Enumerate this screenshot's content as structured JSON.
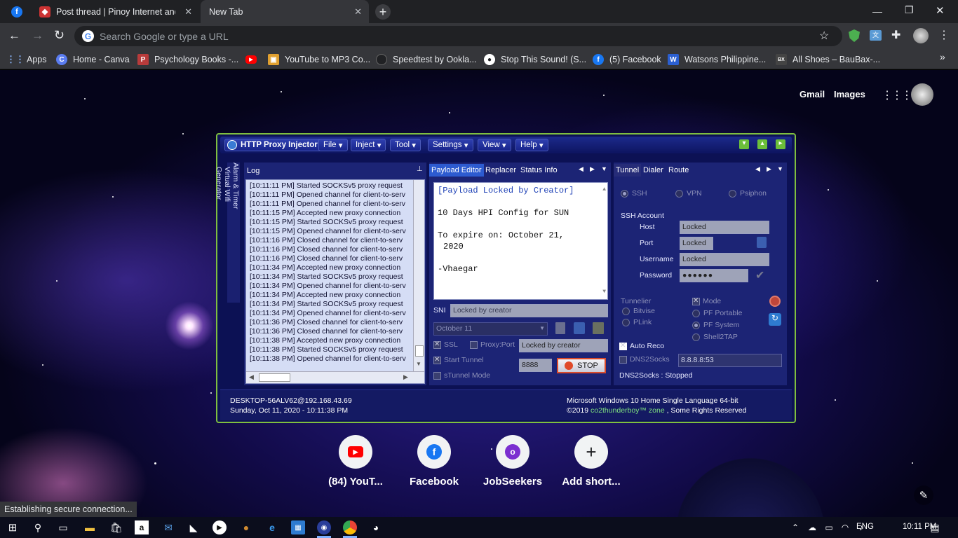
{
  "tabs": [
    {
      "label": "Post thread | Pinoy Internet and Technology Forums",
      "active": false
    },
    {
      "label": "New Tab",
      "active": true
    }
  ],
  "omnibox": {
    "placeholder": "Search Google or type a URL"
  },
  "bookmarks": [
    {
      "label": "Apps",
      "icon": "apps-grid-icon",
      "color": "#8ab4f8"
    },
    {
      "label": "Home - Canva",
      "icon": "canva-icon",
      "color": "#5a7cf0"
    },
    {
      "label": "Psychology Books -...",
      "icon": "pdf-icon",
      "color": "#b83b3b"
    },
    {
      "label": "",
      "icon": "youtube-icon",
      "color": "#ff0000"
    },
    {
      "label": "YouTube to MP3 Co...",
      "icon": "converter-icon",
      "color": "#e0a030"
    },
    {
      "label": "Speedtest by Ookla...",
      "icon": "speedtest-icon",
      "color": "#202124"
    },
    {
      "label": "Stop This Sound! (S...",
      "icon": "stop-sound-icon",
      "color": "#ffffff"
    },
    {
      "label": "(5) Facebook",
      "icon": "facebook-icon",
      "color": "#1877f2"
    },
    {
      "label": "Watsons Philippine...",
      "icon": "watsons-icon",
      "color": "#2b5fd0"
    },
    {
      "label": "All Shoes – BauBax-...",
      "icon": "baubax-icon",
      "color": "#444"
    }
  ],
  "ntp": {
    "gmail": "Gmail",
    "images": "Images"
  },
  "app": {
    "title": "HTTP Proxy Injector",
    "menu": [
      "File",
      "Inject",
      "Tool",
      "Settings",
      "View",
      "Help"
    ],
    "side_tabs": [
      "Alarm & Timer",
      "Virtual Wifi",
      "Generator"
    ],
    "log_title": "Log",
    "log": [
      "[10:11:11 PM] Started SOCKSv5 proxy request",
      "[10:11:11 PM] Opened channel for client-to-serv",
      "[10:11:11 PM] Opened channel for client-to-serv",
      "[10:11:15 PM] Accepted new proxy connection",
      "[10:11:15 PM] Started SOCKSv5 proxy request",
      "[10:11:15 PM] Opened channel for client-to-serv",
      "[10:11:16 PM] Closed channel for client-to-serv",
      "[10:11:16 PM] Closed channel for client-to-serv",
      "[10:11:16 PM] Closed channel for client-to-serv",
      "[10:11:34 PM] Accepted new proxy connection",
      "[10:11:34 PM] Started SOCKSv5 proxy request",
      "[10:11:34 PM] Opened channel for client-to-serv",
      "[10:11:34 PM] Accepted new proxy connection",
      "[10:11:34 PM] Started SOCKSv5 proxy request",
      "[10:11:34 PM] Opened channel for client-to-serv",
      "[10:11:36 PM] Closed channel for client-to-serv",
      "[10:11:36 PM] Closed channel for client-to-serv",
      "[10:11:38 PM] Accepted new proxy connection",
      "[10:11:38 PM] Started SOCKSv5 proxy request",
      "[10:11:38 PM] Opened channel for client-to-serv"
    ],
    "mid_tabs": [
      "Payload Editor",
      "Replacer",
      "Status Info"
    ],
    "payload": [
      "[Payload Locked by Creator]",
      "",
      "10 Days HPI Config for SUN",
      "",
      "To expire on: October 21,",
      "2020",
      "",
      "-Vhaegar"
    ],
    "sni_label": "SNI",
    "sni_value": "Locked by creator",
    "date_select": "October 11",
    "ssl_label": "SSL",
    "proxy_port_label": "Proxy:Port",
    "proxy_value": "Locked by creator",
    "start_tunnel_label": "Start Tunnel",
    "port_value": "8888",
    "stop_label": "STOP",
    "stunnel_label": "sTunnel Mode",
    "right_tabs": [
      "Tunnel",
      "Dialer",
      "Route"
    ],
    "protocols": [
      "SSH",
      "VPN",
      "Psiphon"
    ],
    "ssh_account_label": "SSH Account",
    "host_label": "Host",
    "host_value": "Locked",
    "port_label": "Port",
    "port_field": "Locked",
    "username_label": "Username",
    "username_value": "Locked",
    "password_label": "Password",
    "password_value": "●●●●●●",
    "tunnelier_label": "Tunnelier",
    "bitvise_label": "Bitvise",
    "plink_label": "PLink",
    "mode_label": "Mode",
    "pf_portable_label": "PF Portable",
    "pf_system_label": "PF System",
    "shell2tap_label": "Shell2TAP",
    "auto_reco_label": "Auto Reco",
    "dns2socks_label": "DNS2Socks",
    "dns_value": "8.8.8.8:53",
    "dns_status": "DNS2Socks : Stopped",
    "footer_host": "DESKTOP-56ALV62@192.168.43.69",
    "footer_date": "Sunday, Oct 11, 2020 - 10:11:38 PM",
    "footer_os": "Microsoft Windows 10 Home Single Language 64-bit",
    "footer_copy_prefix": "©2019 ",
    "footer_copy_link": "co2thunderboy™ zone",
    "footer_copy_suffix": " , Some Rights Reserved"
  },
  "shortcuts": [
    {
      "label": "(84) YouT...",
      "icon": "youtube-icon",
      "color": "#ff0000"
    },
    {
      "label": "Facebook",
      "icon": "facebook-icon",
      "color": "#1877f2"
    },
    {
      "label": "JobSeekers",
      "icon": "jobseekers-icon",
      "color": "#7b2fd0"
    },
    {
      "label": "Add short...",
      "icon": "plus-icon",
      "color": "#202124"
    }
  ],
  "status_bar": "Establishing secure connection...",
  "tray": {
    "lang": "ENG",
    "time": "10:11 PM"
  }
}
